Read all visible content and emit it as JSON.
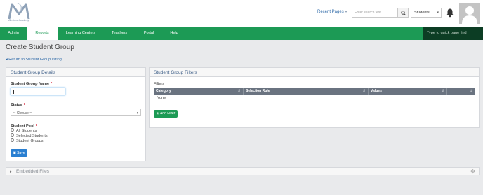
{
  "header": {
    "logo_text": "Milestone Academy",
    "recent_pages_label": "Recent Pages",
    "search_placeholder": "Enter search text",
    "search_scope": "Students"
  },
  "nav": {
    "items": [
      {
        "label": "Admin"
      },
      {
        "label": "Reports"
      },
      {
        "label": "Learning Centers"
      },
      {
        "label": "Teachers"
      },
      {
        "label": "Portal"
      },
      {
        "label": "Help"
      }
    ],
    "active_item": "Reports",
    "quick_find_placeholder": "Type to quick page find"
  },
  "page": {
    "title": "Create Student Group",
    "return_link": "Return to Student Group listing"
  },
  "details": {
    "title": "Student Group Details",
    "name_label": "Student Group Name",
    "name_value": "",
    "status_label": "Status",
    "status_value": "-- Choose --",
    "pool_label": "Student Pool",
    "pool_options": [
      "All Students",
      "Selected Students",
      "Student Groups"
    ],
    "save_label": "Save"
  },
  "filters": {
    "title": "Student Group Filters",
    "section_label": "Filters",
    "columns": [
      "Category",
      "Selection Rule",
      "Values"
    ],
    "empty_row": "None",
    "add_label": "Add Filter"
  },
  "embedded": {
    "label": "Embedded Files"
  },
  "colors": {
    "nav_green": "#1c9a55",
    "quick_find_bg": "#0c3d24",
    "link_blue": "#2f6aa8",
    "save_blue": "#2a7fd1",
    "table_header": "#6a7380",
    "required_red": "#d0021b"
  }
}
